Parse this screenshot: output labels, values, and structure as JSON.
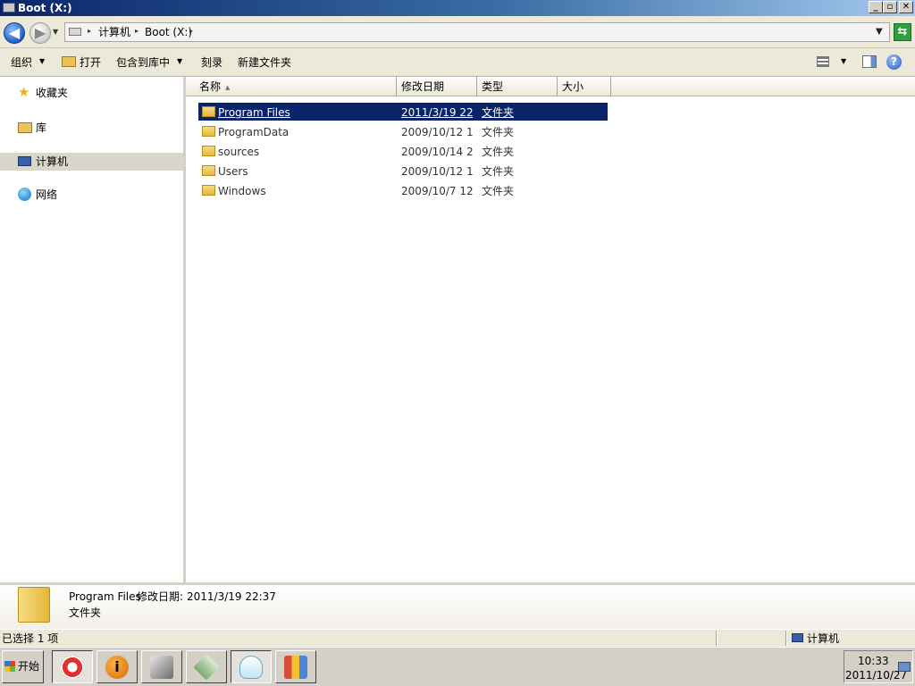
{
  "window": {
    "title": "Boot (X:)",
    "buttons": {
      "minimize": "_",
      "maximize": "▫",
      "close": "✕"
    }
  },
  "address": {
    "crumbs": [
      "计算机",
      "Boot (X:)"
    ]
  },
  "toolbar": {
    "organize": "组织",
    "open": "打开",
    "include_library": "包含到库中",
    "burn": "刻录",
    "new_folder": "新建文件夹"
  },
  "nav": {
    "favorites": "收藏夹",
    "libraries": "库",
    "computer": "计算机",
    "network": "网络"
  },
  "columns": {
    "name": "名称",
    "modified": "修改日期",
    "type": "类型",
    "size": "大小"
  },
  "files": [
    {
      "name": "Program Files",
      "modified": "2011/3/19 22...",
      "type": "文件夹",
      "selected": true
    },
    {
      "name": "ProgramData",
      "modified": "2009/10/12 1...",
      "type": "文件夹"
    },
    {
      "name": "sources",
      "modified": "2009/10/14 2...",
      "type": "文件夹"
    },
    {
      "name": "Users",
      "modified": "2009/10/12 1...",
      "type": "文件夹"
    },
    {
      "name": "Windows",
      "modified": "2009/10/7 12...",
      "type": "文件夹"
    }
  ],
  "details": {
    "name": "Program Files",
    "modified_label": "修改日期:",
    "modified_value": "2011/3/19 22:37",
    "type": "文件夹"
  },
  "status": {
    "selection": "已选择 1 项",
    "location": "计算机"
  },
  "taskbar": {
    "start": "开始",
    "time": "10:33",
    "date": "2011/10/27"
  },
  "icons": {
    "star": "favorites-star-icon",
    "library": "library-icon",
    "computer": "computer-icon",
    "network": "network-icon"
  }
}
